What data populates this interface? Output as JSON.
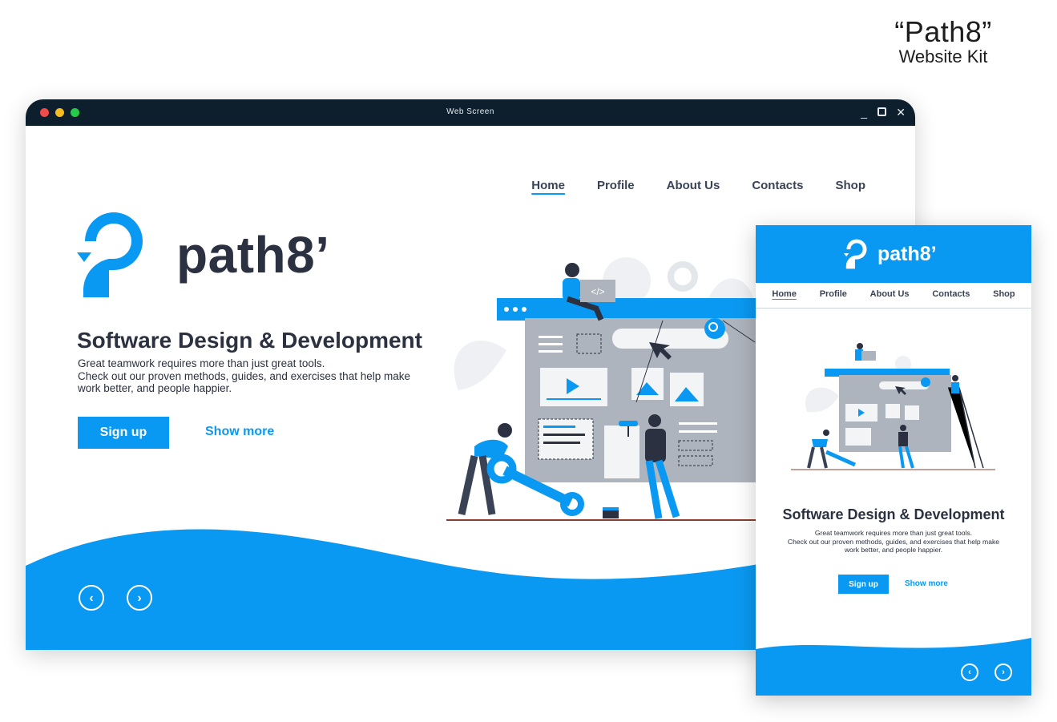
{
  "kit": {
    "title": "“Path8”",
    "subtitle": "Website Kit"
  },
  "window": {
    "title": "Web Screen"
  },
  "nav": [
    "Home",
    "Profile",
    "About Us",
    "Contacts",
    "Shop"
  ],
  "brand": {
    "name": "path8’"
  },
  "hero": {
    "headline": "Software Design & Development",
    "lines": [
      "Great teamwork requires more than just great tools.",
      "Check out our proven methods, guides, and exercises that help make",
      "work better, and people happier."
    ],
    "primary_button": "Sign up",
    "secondary_button": "Show more"
  },
  "mobile": {
    "nav": [
      "Home",
      "Profile",
      "About Us",
      "Contacts",
      "Shop"
    ],
    "headline": "Software Design & Development",
    "lines": [
      "Great teamwork requires more than just great tools.",
      "Check out our proven methods, guides, and exercises that help make",
      "work better, and people happier."
    ],
    "primary_button": "Sign up",
    "secondary_button": "Show more"
  },
  "icons": {
    "prev": "chevron-left-icon",
    "next": "chevron-right-icon",
    "code_tag": "</>"
  },
  "colors": {
    "accent": "#0a99f2",
    "titlebar": "#0d1f2d",
    "text": "#2b3140"
  }
}
